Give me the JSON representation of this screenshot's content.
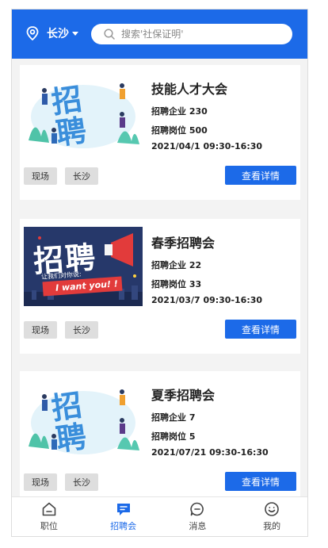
{
  "header": {
    "city": "长沙",
    "search_placeholder": "搜索'社保证明'"
  },
  "fairs": [
    {
      "title": "技能人才大会",
      "companies": "招聘企业 230",
      "positions": "招聘岗位 500",
      "time": "2021/04/1 09:30-16:30",
      "tags": [
        "现场",
        "长沙"
      ],
      "button": "查看详情",
      "image_text": "招聘"
    },
    {
      "title": "春季招聘会",
      "companies": "招聘企业 22",
      "positions": "招聘岗位 33",
      "time": "2021/03/7 09:30-16:30",
      "tags": [
        "现场",
        "长沙"
      ],
      "button": "查看详情",
      "image_text": "招聘",
      "image_sub": "让我们对你说:",
      "image_banner": "I want you! !"
    },
    {
      "title": "夏季招聘会",
      "companies": "招聘企业 7",
      "positions": "招聘岗位 5",
      "time": "2021/07/21 09:30-16:30",
      "tags": [
        "现场",
        "长沙"
      ],
      "button": "查看详情",
      "image_text": "招聘"
    }
  ],
  "nav": [
    {
      "label": "职位",
      "icon": "home-icon",
      "active": false
    },
    {
      "label": "招聘会",
      "icon": "chat-icon",
      "active": true
    },
    {
      "label": "消息",
      "icon": "message-icon",
      "active": false
    },
    {
      "label": "我的",
      "icon": "smile-icon",
      "active": false
    }
  ],
  "colors": {
    "primary": "#1c6ae8",
    "tag_bg": "#dedede",
    "page_bg": "#f3f3f3"
  }
}
